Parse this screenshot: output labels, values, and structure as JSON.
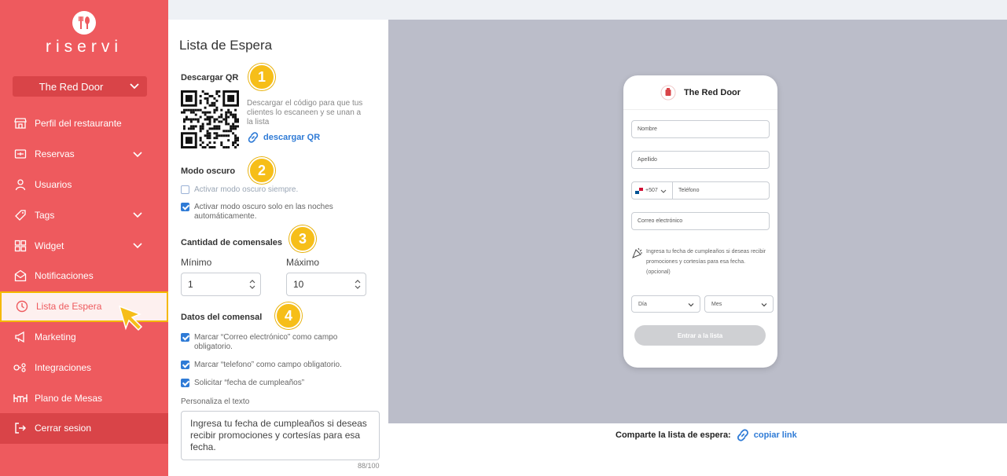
{
  "brand": {
    "name": "riservi",
    "accent": "#ee5a5e",
    "highlight": "#f6be19",
    "link": "#2f7bd6"
  },
  "restaurant_selector": {
    "value": "The Red Door"
  },
  "sidebar": {
    "items": [
      {
        "label": "Perfil del restaurante",
        "icon": "store-icon"
      },
      {
        "label": "Reservas",
        "icon": "calendar-icon"
      },
      {
        "label": "Usuarios",
        "icon": "user-icon"
      },
      {
        "label": "Tags",
        "icon": "tag-icon"
      },
      {
        "label": "Widget",
        "icon": "widget-grid-icon"
      },
      {
        "label": "Notificaciones",
        "icon": "mail-icon"
      },
      {
        "label": "Lista de Espera",
        "icon": "clock-icon"
      },
      {
        "label": "Marketing",
        "icon": "megaphone-icon"
      },
      {
        "label": "Integraciones",
        "icon": "integrations-icon"
      },
      {
        "label": "Plano de Mesas",
        "icon": "table-plan-icon"
      },
      {
        "label": "Cerrar sesion",
        "icon": "logout-icon"
      }
    ]
  },
  "panel": {
    "title": "Lista de Espera",
    "qr": {
      "title": "Descargar QR",
      "badge": "1",
      "description": "Descargar el código para que tus clientes lo escaneen y se unan a la lista",
      "link": "descargar QR"
    },
    "dark_mode": {
      "title": "Modo oscuro",
      "badge": "2",
      "always": "Activar modo oscuro siempre.",
      "nights": "Activar modo oscuro solo en las noches automáticamente."
    },
    "guests": {
      "title": "Cantidad de comensales",
      "badge": "3",
      "min_label": "Mínimo",
      "min_value": "1",
      "max_label": "Máximo",
      "max_value": "10"
    },
    "guest_data": {
      "title": "Datos del comensal",
      "badge": "4",
      "email_required": "Marcar “Correo electrónico” como campo obligatorio.",
      "phone_required": "Marcar “telefono” como campo obligatorio.",
      "birthday": "Solicitar “fecha de cumpleaños”",
      "customize_label": "Personaliza el texto",
      "text": "Ingresa tu fecha de cumpleaños si deseas recibir promociones y cortesías para esa fecha.",
      "counter": "88/100"
    }
  },
  "preview": {
    "restaurant": "The Red Door",
    "first_name": "Nombre",
    "last_name": "Apellido",
    "country_code": "+507",
    "phone": "Teléfono",
    "email": "Correo electrónico",
    "birthday_text": "Ingresa tu fecha de cumpleaños si deseas recibir promociones y cortesías para esa fecha. (opcional)",
    "day": "Día",
    "month": "Mes",
    "submit": "Entrar a la lista"
  },
  "share": {
    "label": "Comparte la lista de espera:",
    "link": "copiar link"
  }
}
